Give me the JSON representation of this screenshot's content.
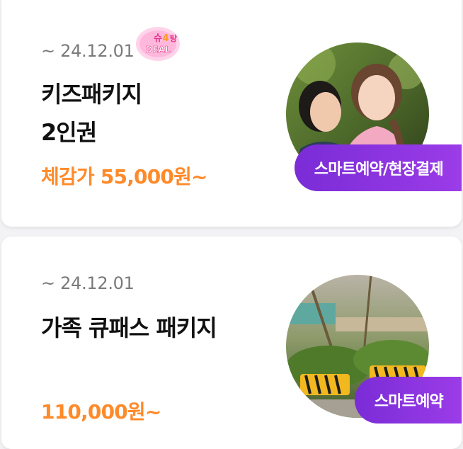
{
  "cards": [
    {
      "date": "~ 24.12.01",
      "title_line1": "키즈패키지",
      "title_line2": "2인권",
      "price": "체감가 55,000원~",
      "badge": "스마트예약/현장결제",
      "deal_logo": "슈4탕 DEAL"
    },
    {
      "date": "~ 24.12.01",
      "title_line1": "가족 큐패스 패키지",
      "price": "110,000원~",
      "badge": "스마트예약"
    }
  ],
  "colors": {
    "price": "#ff8a2a",
    "badge_start": "#7a2cd6",
    "badge_end": "#9b3ce8"
  }
}
